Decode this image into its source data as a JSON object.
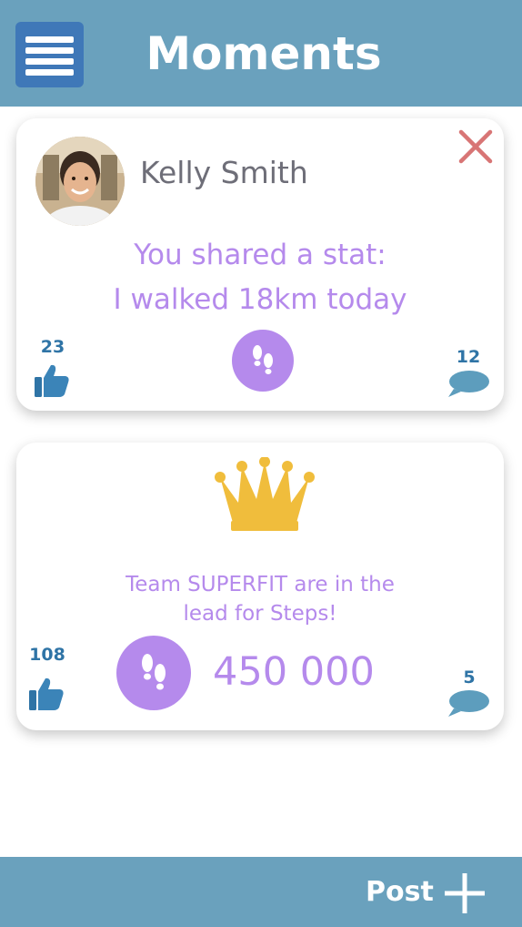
{
  "app": {
    "title": "Moments"
  },
  "card1": {
    "user_name": "Kelly Smith",
    "line1": "You shared a stat:",
    "line2": "I walked 18km today",
    "likes": "23",
    "comments": "12"
  },
  "card2": {
    "line1": "Team SUPERFIT are in the",
    "line2": "lead for Steps!",
    "steps": "450 000",
    "likes": "108",
    "comments": "5"
  },
  "footer": {
    "post_label": "Post"
  },
  "colors": {
    "header": "#6aa1bd",
    "accent_purple": "#b58aec",
    "like_blue": "#2f74a6",
    "crown_gold": "#f0bd3c",
    "close_red": "#d87575"
  },
  "icons": [
    "menu-icon",
    "close-icon",
    "thumbs-up-icon",
    "steps-icon",
    "comment-bubble-icon",
    "crown-icon",
    "plus-icon"
  ]
}
